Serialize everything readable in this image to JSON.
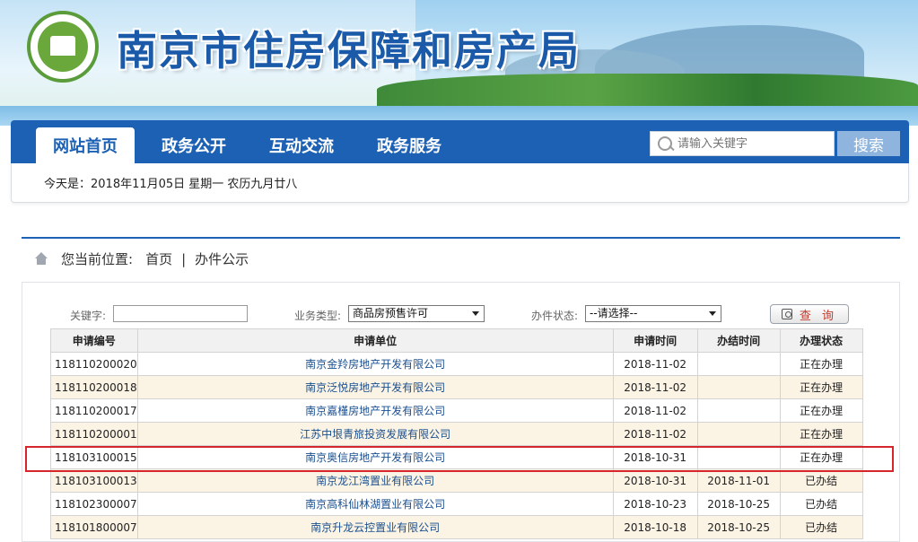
{
  "header": {
    "site_title": "南京市住房保障和房产局"
  },
  "nav": {
    "items": [
      {
        "label": "网站首页"
      },
      {
        "label": "政务公开"
      },
      {
        "label": "互动交流"
      },
      {
        "label": "政务服务"
      }
    ],
    "search_placeholder": "请输入关键字",
    "search_button": "搜索"
  },
  "date_bar": {
    "text": "今天是：2018年11月05日 星期一   农历九月廿八"
  },
  "breadcrumb": {
    "prefix": "您当前位置:",
    "home": "首页",
    "separator": "|",
    "current": "办件公示"
  },
  "filters": {
    "keyword_label": "关键字:",
    "keyword_value": "",
    "type_label": "业务类型:",
    "type_value": "商品房预售许可",
    "status_label": "办件状态:",
    "status_value": "--请选择--",
    "query_button": "查 询"
  },
  "table": {
    "headers": [
      "申请编号",
      "申请单位",
      "申请时间",
      "办结时间",
      "办理状态"
    ],
    "rows": [
      [
        "118110200020",
        "南京金羚房地产开发有限公司",
        "2018-11-02",
        "",
        "正在办理"
      ],
      [
        "118110200018",
        "南京泛悦房地产开发有限公司",
        "2018-11-02",
        "",
        "正在办理"
      ],
      [
        "118110200017",
        "南京嘉槿房地产开发有限公司",
        "2018-11-02",
        "",
        "正在办理"
      ],
      [
        "118110200001",
        "江苏中垠青旅投资发展有限公司",
        "2018-11-02",
        "",
        "正在办理"
      ],
      [
        "118103100015",
        "南京奥信房地产开发有限公司",
        "2018-10-31",
        "",
        "正在办理"
      ],
      [
        "118103100013",
        "南京龙江湾置业有限公司",
        "2018-10-31",
        "2018-11-01",
        "已办结"
      ],
      [
        "118102300007",
        "南京高科仙林湖置业有限公司",
        "2018-10-23",
        "2018-10-25",
        "已办结"
      ],
      [
        "118101800007",
        "南京升龙云控置业有限公司",
        "2018-10-18",
        "2018-10-25",
        "已办结"
      ]
    ]
  },
  "colors": {
    "nav_blue": "#1d61b5",
    "highlight_red": "#d6262b",
    "row_alt": "#fbf3e4"
  }
}
